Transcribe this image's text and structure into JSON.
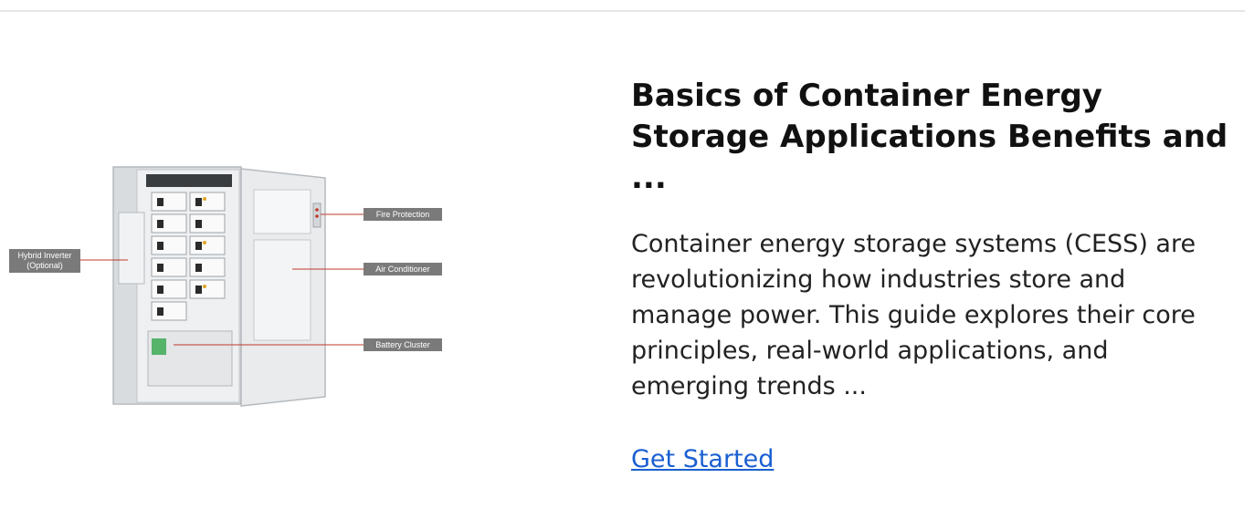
{
  "article": {
    "title": "Basics of Container Energy Storage Applications Benefits and ...",
    "excerpt": "Container energy storage systems (CESS) are revolutionizing how industries store and manage power. This guide explores their core principles, real-world applications, and emerging trends ...",
    "cta_label": "Get Started"
  },
  "figure": {
    "callouts": {
      "hybrid_inverter_line1": "Hybrid Inverter",
      "hybrid_inverter_line2": "(Optional)",
      "fire_protection": "Fire Protection",
      "air_conditioner": "Air Conditioner",
      "battery_cluster": "Battery Cluster"
    }
  },
  "colors": {
    "link": "#1a5fd1",
    "callout_bg": "#7a7a7a",
    "leader_line": "#c0392b"
  }
}
